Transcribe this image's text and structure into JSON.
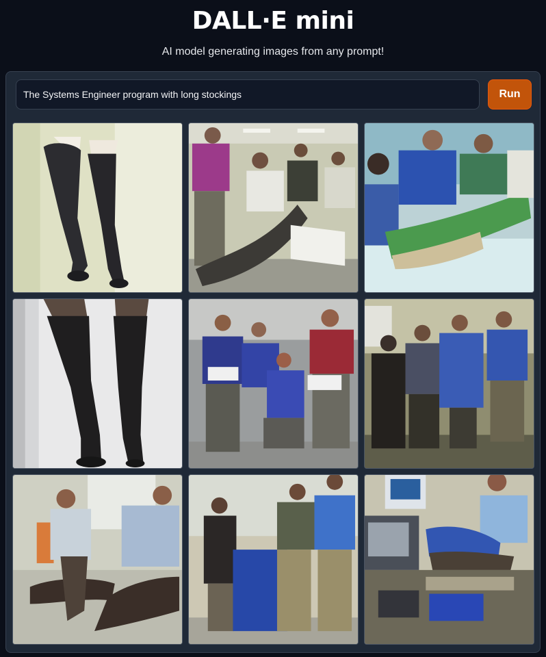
{
  "header": {
    "title": "DALL·E mini",
    "subtitle": "AI model generating images from any prompt!"
  },
  "prompt": {
    "value": "The Systems Engineer program with long stockings"
  },
  "run_button": {
    "label": "Run"
  },
  "colors": {
    "page_bg": "#0b0f19",
    "panel_bg": "#1f2937",
    "input_bg": "#111827",
    "run_button_bg": "#c2540a"
  },
  "gallery": {
    "tiles": [
      {
        "subject": "legs in black thigh-high stockings, pale green background"
      },
      {
        "subject": "group of office workers, one reclining in stockings"
      },
      {
        "subject": "people in blue shirts sitting on floor with green stockings"
      },
      {
        "subject": "legs in black thigh-high stockings, white background"
      },
      {
        "subject": "group of men in blue and red shirts posing in office"
      },
      {
        "subject": "group of people in blue shirts standing together"
      },
      {
        "subject": "two men in striped shirts kneeling in stockings"
      },
      {
        "subject": "group of people standing near a blue box"
      },
      {
        "subject": "person lying on a desk in an office"
      }
    ]
  }
}
